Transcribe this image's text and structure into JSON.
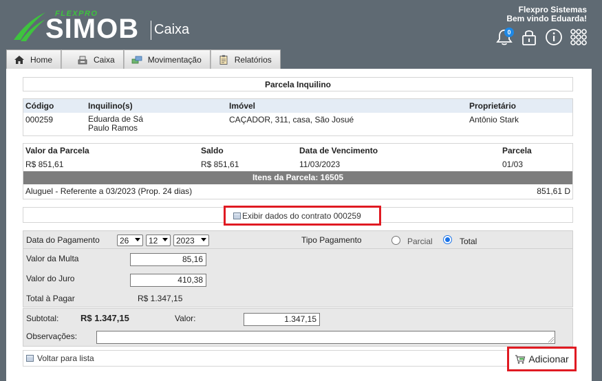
{
  "brand": {
    "subtitle": "FLEXPRO",
    "name": "SIMOB",
    "module": "Caixa",
    "color_green": "#3ec33e"
  },
  "user": {
    "company": "Flexpro Sistemas",
    "welcome": "Bem vindo Eduarda!"
  },
  "notifications": {
    "count": "0"
  },
  "nav": {
    "tabs": [
      {
        "label": "Home",
        "icon": "home-icon"
      },
      {
        "label": "Caixa",
        "icon": "cash-register-icon"
      },
      {
        "label": "Movimentação",
        "icon": "money-transfer-icon"
      },
      {
        "label": "Relatórios",
        "icon": "clipboard-icon"
      }
    ]
  },
  "page": {
    "title": "Parcela Inquilino"
  },
  "tenant_table": {
    "headers": [
      "Código",
      "Inquilino(s)",
      "Imóvel",
      "Proprietário"
    ],
    "row": {
      "code": "000259",
      "tenant_line1": "Eduarda de Sá",
      "tenant_line2": "Paulo Ramos",
      "property": "CAÇADOR, 311, casa, São Josué",
      "owner": "Antônio Stark"
    }
  },
  "installment_table": {
    "headers": [
      "Valor da Parcela",
      "Saldo",
      "Data de Vencimento",
      "Parcela"
    ],
    "row": {
      "value": "R$ 851,61",
      "balance": "R$ 851,61",
      "due_date": "11/03/2023",
      "installment": "01/03"
    },
    "items_title": "Itens da Parcela: 16505",
    "item": {
      "description": "Aluguel - Referente a 03/2023 (Prop. 24 dias)",
      "amount": "851,61 D"
    }
  },
  "contract_link": {
    "label": "Exibir dados do contrato 000259"
  },
  "payment": {
    "date_label": "Data do Pagamento",
    "day": "26",
    "month": "12",
    "year": "2023",
    "type_label": "Tipo Pagamento",
    "option_partial": "Parcial",
    "option_total": "Total",
    "selected": "Total",
    "fine_label": "Valor da Multa",
    "fine_value": "85,16",
    "interest_label": "Valor do Juro",
    "interest_value": "410,38",
    "total_label": "Total à Pagar",
    "total_value": "R$ 1.347,15"
  },
  "summary": {
    "subtotal_label": "Subtotal:",
    "subtotal_value": "R$ 1.347,15",
    "value_label": "Valor:",
    "value_input": "1.347,15",
    "notes_label": "Observações:"
  },
  "footer": {
    "back_label": "Voltar para lista",
    "add_label": "Adicionar"
  }
}
